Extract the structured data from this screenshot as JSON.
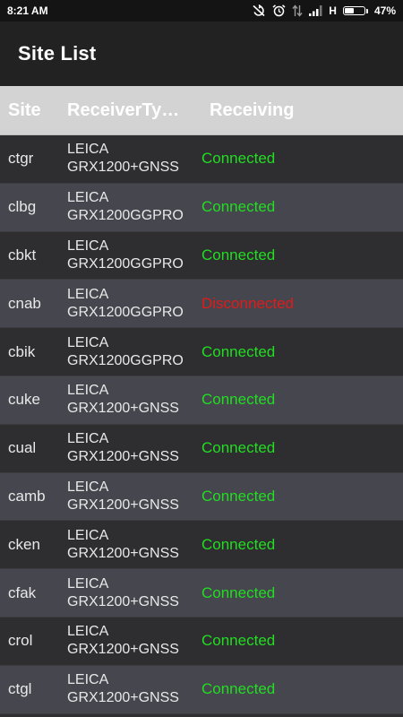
{
  "status_bar": {
    "time": "8:21 AM",
    "network_letter": "H",
    "battery_percent": "47%",
    "battery_level": 0.47,
    "icons": [
      "sync-off-icon",
      "alarm-icon",
      "data-arrows-icon",
      "signal-icon"
    ]
  },
  "app_bar": {
    "title": "Site List"
  },
  "table": {
    "headers": {
      "site": "Site",
      "receiver": "ReceiverTy…",
      "receiving": "Receiving"
    },
    "status_colors": {
      "Connected": "#22dd22",
      "Disconnected": "#e01b1b"
    },
    "rows": [
      {
        "site": "ctgr",
        "brand": "LEICA",
        "model": "GRX1200+GNSS",
        "status": "Connected"
      },
      {
        "site": "clbg",
        "brand": "LEICA",
        "model": "GRX1200GGPRO",
        "status": "Connected"
      },
      {
        "site": "cbkt",
        "brand": "LEICA",
        "model": "GRX1200GGPRO",
        "status": "Connected"
      },
      {
        "site": "cnab",
        "brand": "LEICA",
        "model": "GRX1200GGPRO",
        "status": "Disconnected"
      },
      {
        "site": "cbik",
        "brand": "LEICA",
        "model": "GRX1200GGPRO",
        "status": "Connected"
      },
      {
        "site": "cuke",
        "brand": "LEICA",
        "model": "GRX1200+GNSS",
        "status": "Connected"
      },
      {
        "site": "cual",
        "brand": "LEICA",
        "model": "GRX1200+GNSS",
        "status": "Connected"
      },
      {
        "site": "camb",
        "brand": "LEICA",
        "model": "GRX1200+GNSS",
        "status": "Connected"
      },
      {
        "site": "cken",
        "brand": "LEICA",
        "model": "GRX1200+GNSS",
        "status": "Connected"
      },
      {
        "site": "cfak",
        "brand": "LEICA",
        "model": "GRX1200+GNSS",
        "status": "Connected"
      },
      {
        "site": "crol",
        "brand": "LEICA",
        "model": "GRX1200+GNSS",
        "status": "Connected"
      },
      {
        "site": "ctgl",
        "brand": "LEICA",
        "model": "GRX1200+GNSS",
        "status": "Connected"
      }
    ]
  }
}
